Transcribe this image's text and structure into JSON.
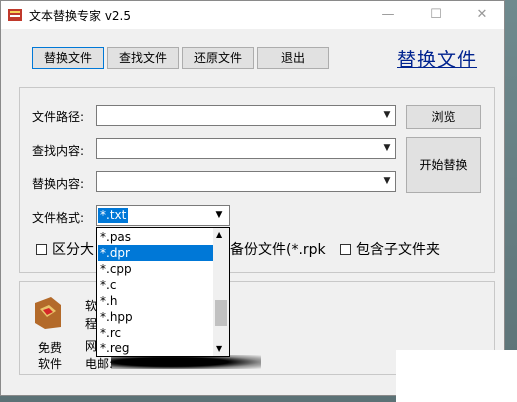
{
  "window": {
    "title": "文本替换专家 v2.5",
    "minimize": "—",
    "maximize": "☐",
    "close": "✕"
  },
  "toolbar": {
    "buttons": [
      "替换文件",
      "查找文件",
      "还原文件",
      "退出"
    ],
    "brand": "替换文件"
  },
  "form": {
    "path_label": "文件路径:",
    "find_label": "查找内容:",
    "replace_label": "替换内容:",
    "format_label": "文件格式:",
    "path_value": "",
    "find_value": "",
    "replace_value": "",
    "browse_button": "浏览",
    "start_button": "开始替换"
  },
  "format_dropdown": {
    "selected": "*.txt",
    "options": [
      "*.pas",
      "*.dpr",
      "*.cpp",
      "*.c",
      "*.h",
      "*.hpp",
      "*.rc",
      "*.reg"
    ],
    "highlighted": "*.dpr"
  },
  "options": {
    "case_label_partial": "区分大",
    "backup_label_partial": "备份文件(*.rpk",
    "subfolder_label": "包含子文件夹"
  },
  "info": {
    "free_label_line1": "免费",
    "free_label_line2": "软件",
    "line1": "软",
    "line2": "程",
    "line3": "网",
    "line4": "电邮:"
  }
}
